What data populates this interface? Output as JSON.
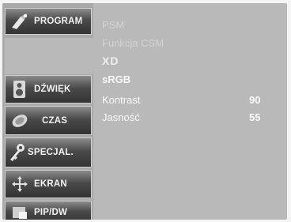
{
  "sidebar": {
    "items": [
      {
        "label": "PROGRAM",
        "icon": "satellite-icon"
      },
      {
        "label": "DŹWIĘK",
        "icon": "speaker-icon"
      },
      {
        "label": "CZAS",
        "icon": "clock-icon"
      },
      {
        "label": "SPECJAL.",
        "icon": "key-icon"
      },
      {
        "label": "EKRAN",
        "icon": "move-arrows-icon"
      },
      {
        "label": "PIP/DW",
        "icon": "pip-icon"
      }
    ]
  },
  "menu": {
    "items": [
      {
        "label": "PSM"
      },
      {
        "label": "Funkcja CSM"
      },
      {
        "label": "XD"
      },
      {
        "label": "sRGB"
      },
      {
        "label": "Kontrast",
        "value": "90"
      },
      {
        "label": "Jasność",
        "value": "55"
      }
    ]
  },
  "colors": {
    "panel": "#b9b9b9",
    "sidebar": "#a9a9a9",
    "button_dark": "#333333",
    "text": "#f8f8f8"
  }
}
